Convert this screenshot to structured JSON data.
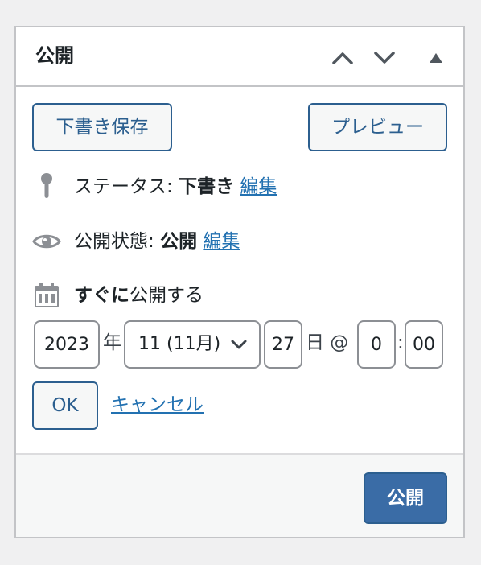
{
  "panel": {
    "title": "公開",
    "header_controls": [
      "chevron-up-icon",
      "chevron-down-icon",
      "triangle-up-icon"
    ]
  },
  "actions": {
    "save_draft_label": "下書き保存",
    "preview_label": "プレビュー"
  },
  "status": {
    "icon": "pin-icon",
    "label": "ステータス:",
    "value": "下書き",
    "edit_label": "編集"
  },
  "visibility": {
    "icon": "eye-icon",
    "label": "公開状態:",
    "value": "公開",
    "edit_label": "編集"
  },
  "schedule": {
    "icon": "calendar-icon",
    "value": "すぐに",
    "label": "公開する"
  },
  "datetime": {
    "year": "2023",
    "year_suffix": "年",
    "month": "11 (11月)",
    "day": "27",
    "day_suffix": "日 @",
    "hour": "0",
    "time_sep": ":",
    "minute": "00",
    "ok_label": "OK",
    "cancel_label": "キャンセル"
  },
  "footer": {
    "publish_label": "公開"
  },
  "colors": {
    "accent": "#2271b1",
    "primary_button": "#3a6ca6",
    "border": "#c3c4c7",
    "background": "#f0f0f1"
  }
}
